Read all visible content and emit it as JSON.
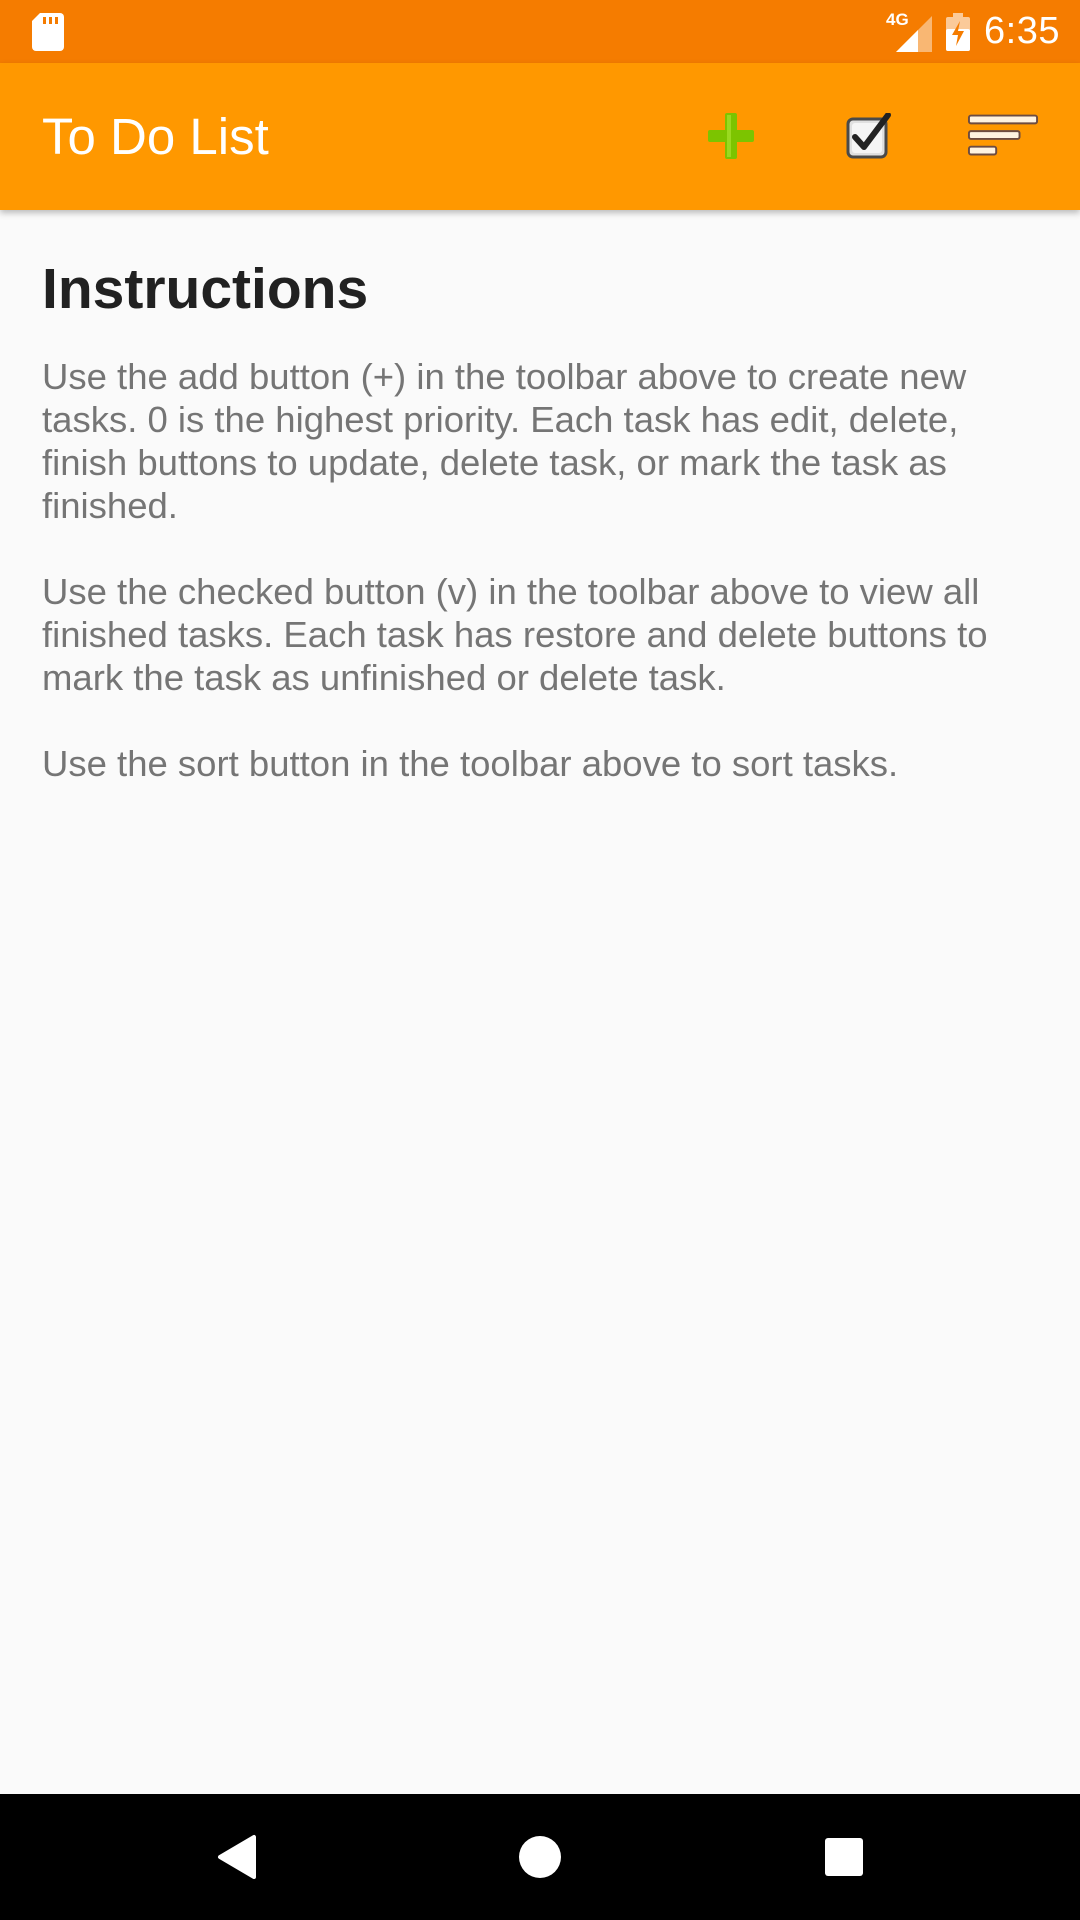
{
  "status_bar": {
    "time": "6:35",
    "network": "4G",
    "left_icon": "sd-card-icon",
    "icons": [
      "signal-icon",
      "battery-charging-icon"
    ]
  },
  "app_bar": {
    "title": "To Do List",
    "actions": [
      {
        "name": "add-task",
        "icon": "plus-icon",
        "color": "#7cc400"
      },
      {
        "name": "view-finished",
        "icon": "checkbox-checked-icon"
      },
      {
        "name": "sort",
        "icon": "sort-lines-icon"
      }
    ],
    "color": "#ff9800"
  },
  "content": {
    "heading": "Instructions",
    "paragraphs": [
      "Use the add button (+) in the toolbar above to create new tasks. 0 is the highest priority. Each task has edit, delete, finish buttons to update, delete task, or mark the task as finished.",
      "Use the checked button (v) in the toolbar above to view all finished tasks. Each task has restore and delete buttons to mark the task as unfinished or delete task.",
      "Use the sort button in the toolbar above to sort tasks."
    ]
  },
  "nav_bar": {
    "buttons": [
      "back-icon",
      "home-icon",
      "recents-icon"
    ]
  },
  "colors": {
    "status_bar": "#f57c00",
    "app_bar": "#ff9800",
    "background": "#fafafa",
    "heading_text": "#212121",
    "body_text": "#757575"
  }
}
